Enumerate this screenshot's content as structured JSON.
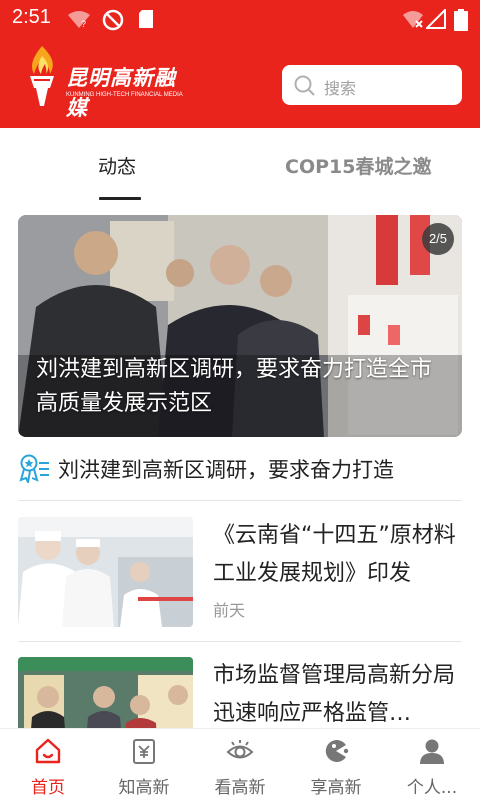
{
  "status_bar": {
    "time": "2:51"
  },
  "app": {
    "logo_cn": "昆明高新融媒",
    "logo_en": "KUNMING HIGH-TECH FINANCIAL MEDIA",
    "brand_color": "#e8241d"
  },
  "search": {
    "placeholder": "搜索"
  },
  "tabs": [
    {
      "label": "动态",
      "active": true
    },
    {
      "label": "COP15春城之邀",
      "active": false
    }
  ],
  "hero": {
    "pager": "2/5",
    "caption": "刘洪建到高新区调研，要求奋力打造全市高质量发展示范区"
  },
  "headline": {
    "text": "刘洪建到高新区调研，要求奋力打造",
    "icon": "award-badge-icon"
  },
  "news": [
    {
      "title": "《云南省“十四五”原材料工业发展规划》印发",
      "time": "前天"
    },
    {
      "title": "市场监督管理局高新分局迅速响应严格监管…",
      "time": ""
    }
  ],
  "bottom_nav": [
    {
      "label": "首页",
      "icon": "home-icon",
      "active": true
    },
    {
      "label": "知高新",
      "icon": "document-icon",
      "active": false
    },
    {
      "label": "看高新",
      "icon": "eye-icon",
      "active": false
    },
    {
      "label": "享高新",
      "icon": "game-icon",
      "active": false
    },
    {
      "label": "个人...",
      "icon": "user-icon",
      "active": false
    }
  ]
}
